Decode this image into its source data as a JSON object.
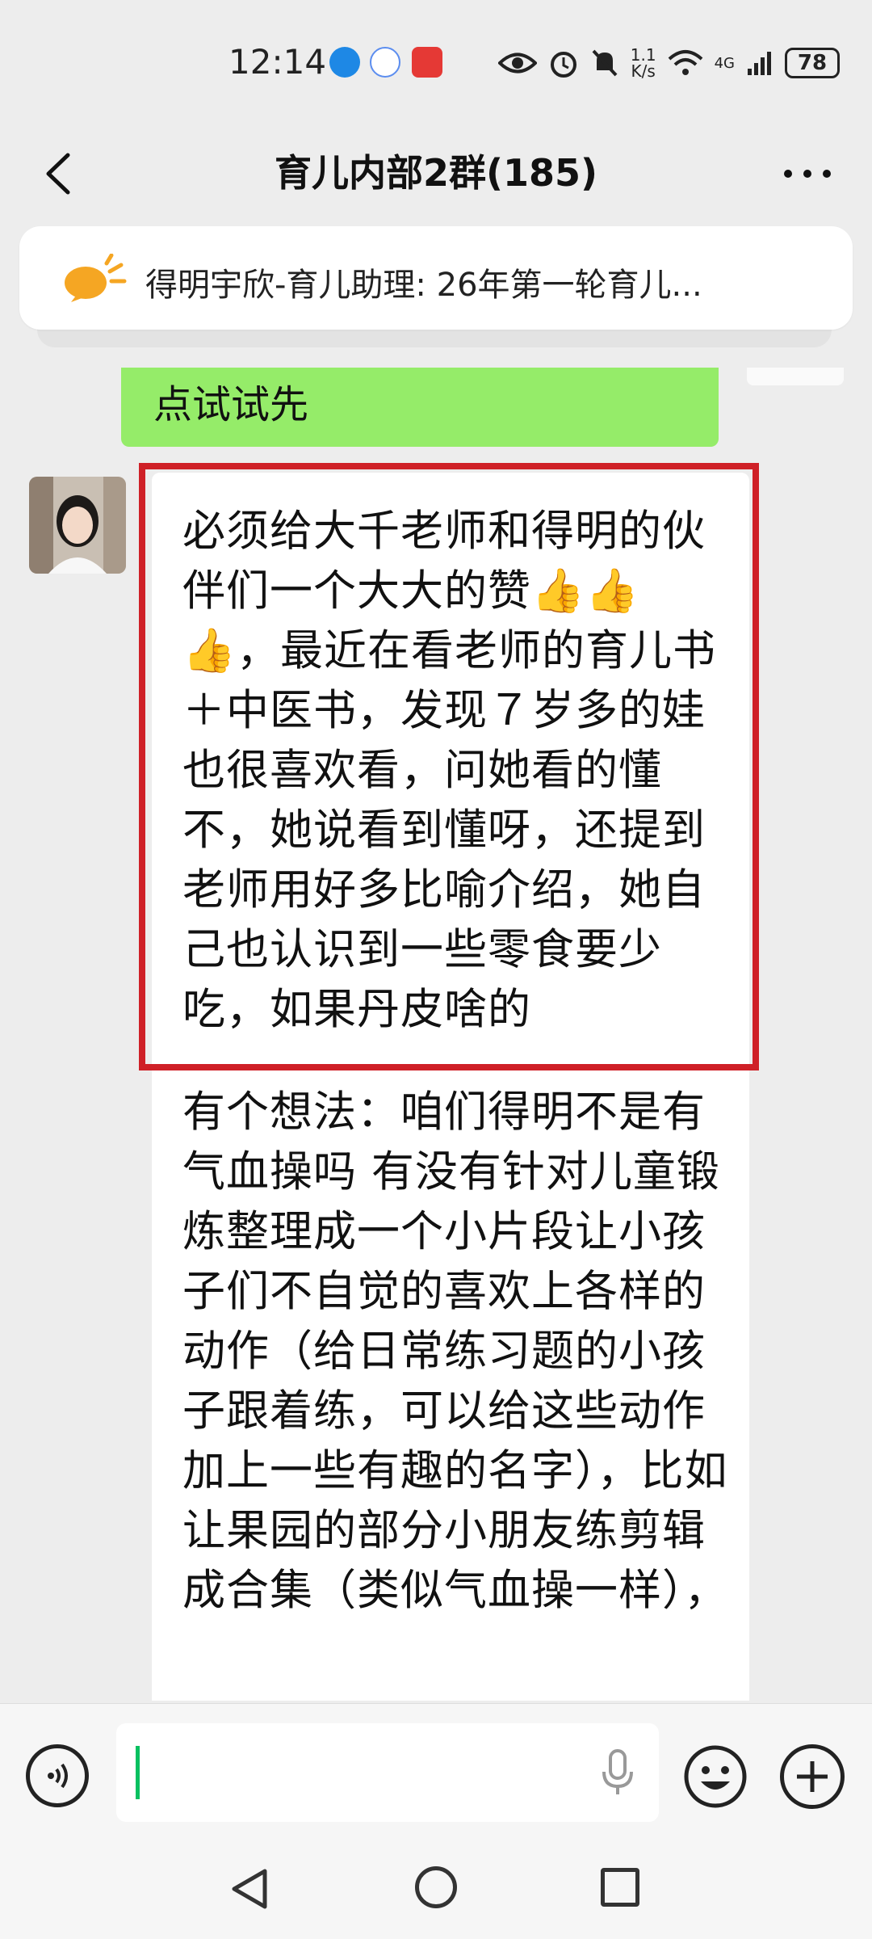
{
  "status_bar": {
    "time": "12:14",
    "net_speed_value": "1.1",
    "net_speed_unit": "K/s",
    "network": "4G",
    "battery": "78"
  },
  "header": {
    "title": "育儿内部2群(185)"
  },
  "pinned": {
    "text": "得明宇欣-育儿助理: 26年第一轮育儿..."
  },
  "messages": {
    "previous_own": "点试试先",
    "incoming_para1": "必须给大千老师和得明的伙伴们一个大大的赞👍👍👍，最近在看老师的育儿书＋中医书，发现７岁多的娃也很喜欢看，问她看的懂不，她说看到懂呀，还提到老师用好多比喻介绍，她自己也认识到一些零食要少吃，如果丹皮啥的",
    "incoming_para2": "有个想法：咱们得明不是有气血操吗 有没有针对儿童锻炼整理成一个小片段让小孩子们不自觉的喜欢上各样的动作（给日常练习题的小孩子跟着练，可以给这些动作加上一些有趣的名字），比如让果园的部分小朋友练剪辑成合集（类似气血操一样），"
  },
  "colors": {
    "own_bubble": "#95ec69",
    "highlight": "#cf2027",
    "cursor": "#07c160"
  }
}
